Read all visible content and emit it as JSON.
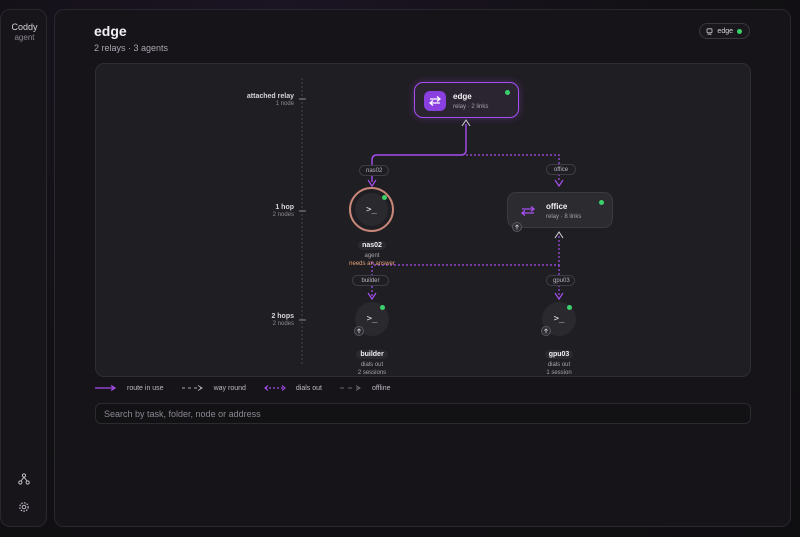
{
  "app": {
    "name": "Coddy",
    "subtitle": "agent"
  },
  "page": {
    "title": "edge",
    "subtitle": "2 relays · 3 agents"
  },
  "header_chip": {
    "label": "edge",
    "status_color": "#3ad16a"
  },
  "tiers": [
    {
      "title": "attached relay",
      "count": "1 node"
    },
    {
      "title": "1 hop",
      "count": "2 nodes"
    },
    {
      "title": "2 hops",
      "count": "2 nodes"
    }
  ],
  "relays": {
    "edge": {
      "name": "edge",
      "detail": "relay · 2 links",
      "status": "online"
    },
    "office": {
      "name": "office",
      "detail": "relay · 8 links",
      "status": "online"
    }
  },
  "link_labels": {
    "nas02": "nas02",
    "office": "office",
    "builder": "builder",
    "gpu03": "gpu03"
  },
  "agents": {
    "nas02": {
      "name": "nas02",
      "role": "agent",
      "note": "needs an answer",
      "status": "online"
    },
    "builder": {
      "name": "builder",
      "mode": "dials out",
      "sessions": "2 sessions",
      "status": "online"
    },
    "gpu03": {
      "name": "gpu03",
      "mode": "dials out",
      "sessions": "1 session",
      "status": "online"
    }
  },
  "legend": {
    "route_in_use": "route in use",
    "way_round": "way round",
    "dials_out": "dials out",
    "offline": "offline"
  },
  "search": {
    "placeholder": "Search by task, folder, node or address",
    "value": ""
  },
  "icons": {
    "relay": "arrows-swap-icon",
    "agent": "terminal-prompt-icon",
    "agent_glyph": ">_",
    "topology": "topology-icon",
    "settings": "gear-icon",
    "uplink": "arrow-up-icon",
    "chip": "device-icon"
  },
  "colors": {
    "accent": "#a64ff0",
    "online": "#3ad16a",
    "warning": "#c9877a"
  }
}
